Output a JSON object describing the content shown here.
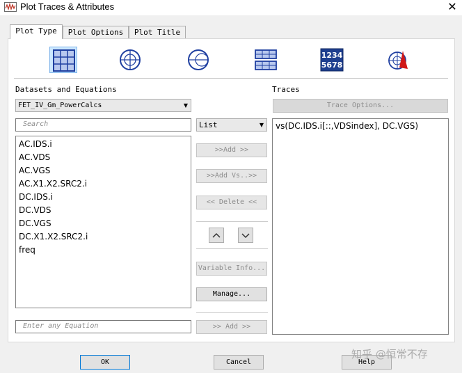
{
  "window": {
    "title": "Plot Traces & Attributes",
    "close_glyph": "✕"
  },
  "tabs": [
    {
      "label": "Plot Type",
      "active": true
    },
    {
      "label": "Plot Options",
      "active": false
    },
    {
      "label": "Plot Title",
      "active": false
    }
  ],
  "plot_types": [
    {
      "icon": "rectangular-grid-icon",
      "selected": true
    },
    {
      "icon": "polar-plot-icon",
      "selected": false
    },
    {
      "icon": "smith-chart-icon",
      "selected": false
    },
    {
      "icon": "stacked-rectangular-icon",
      "selected": false
    },
    {
      "icon": "list-table-icon",
      "text_top": "1234",
      "text_bottom": "5678",
      "selected": false
    },
    {
      "icon": "antenna-plot-icon",
      "selected": false
    }
  ],
  "datasets": {
    "section_label": "Datasets and Equations",
    "selected_dataset": "FET_IV_Gm_PowerCalcs",
    "search_placeholder": "Search",
    "items": [
      "AC.IDS.i",
      "AC.VDS",
      "AC.VGS",
      "AC.X1.X2.SRC2.i",
      "DC.IDS.i",
      "DC.VDS",
      "DC.VGS",
      "DC.X1.X2.SRC2.i",
      "freq"
    ],
    "equation_placeholder": "Enter any Equation"
  },
  "middle": {
    "view_mode": "List",
    "add_label": ">>Add >>",
    "add_vs_label": ">>Add Vs..>>",
    "delete_label": "<< Delete <<",
    "variable_info_label": "Variable Info...",
    "manage_label": "Manage...",
    "add_equation_label": ">> Add >>"
  },
  "traces": {
    "section_label": "Traces",
    "trace_options_label": "Trace Options...",
    "items": [
      "vs(DC.IDS.i[::,VDSindex], DC.VGS)"
    ]
  },
  "footer": {
    "ok_label": "OK",
    "cancel_label": "Cancel",
    "help_label": "Help"
  },
  "watermark": "知乎 @恒常不存"
}
